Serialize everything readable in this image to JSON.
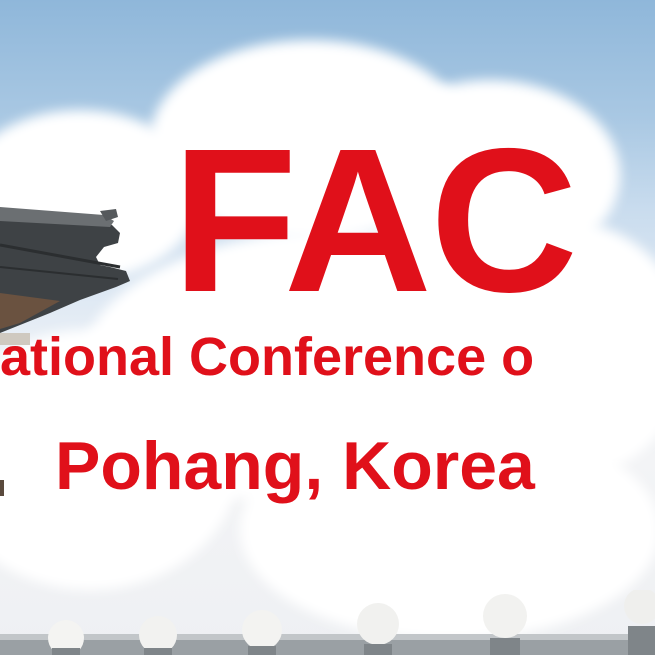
{
  "banner": {
    "title": "FAC",
    "subtitle": "ational Conference o",
    "location": "Pohang, Korea",
    "colors": {
      "text_red": "#e0101a",
      "sky_blue": "#8fb7da",
      "cloud_white": "#ffffff"
    }
  }
}
